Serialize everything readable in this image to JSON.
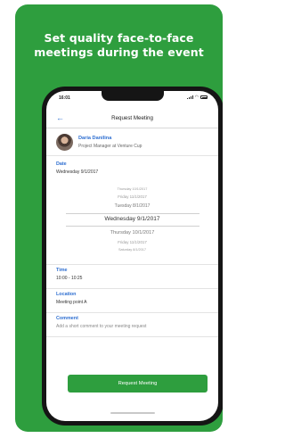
{
  "headline": {
    "line1": "Set quality face-to-face",
    "line2": "meetings during the event"
  },
  "status_bar": {
    "time": "16:01"
  },
  "nav": {
    "back_glyph": "←",
    "title": "Request Meeting"
  },
  "user": {
    "name": "Daria Danilina",
    "role": "Project Manager at Venture Cup"
  },
  "date": {
    "label": "Date",
    "value": "Wednesday 9/1/2017",
    "wheel": [
      "Thursday 10/1/2017",
      "Friday 11/1/2017",
      "Tuesday 8/1/2017",
      "Wednesday 9/1/2017",
      "Thursday 10/1/2017",
      "Friday 11/1/2017",
      "Saturday 8/1/2017"
    ]
  },
  "time": {
    "label": "Time",
    "value": "10:00 - 10:25"
  },
  "location": {
    "label": "Location",
    "value": "Meeting point A"
  },
  "comment": {
    "label": "Comment",
    "placeholder": "Add a short comment to your meeting request"
  },
  "request_button": {
    "label": "Request Meeting"
  },
  "colors": {
    "brand_green": "#2e9e3e",
    "link_blue": "#2f6fd1"
  }
}
